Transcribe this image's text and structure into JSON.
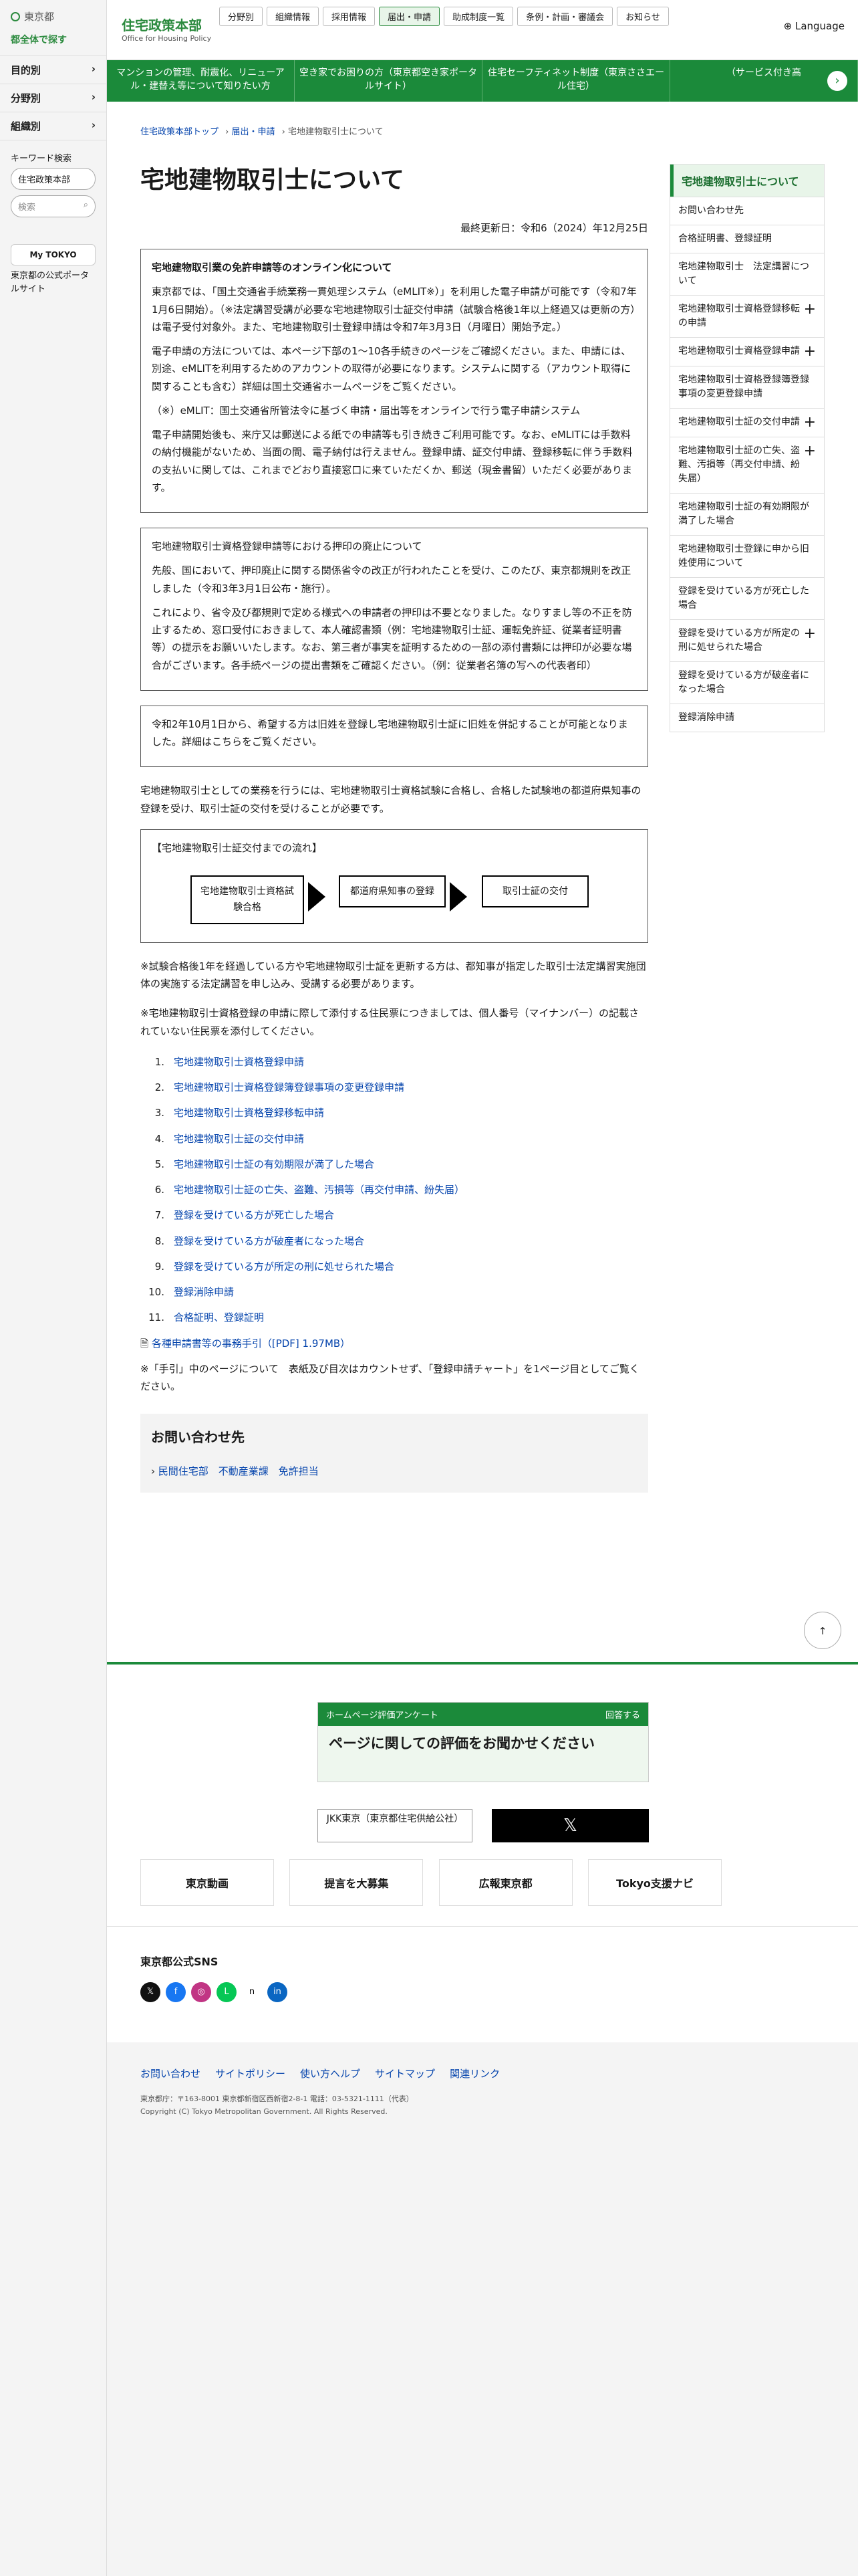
{
  "left": {
    "logo": "東京都",
    "all": "都全体で探す",
    "nav": [
      "目的別",
      "分野別",
      "組織別"
    ],
    "keyword": "キーワード検索",
    "select": "住宅政策本部",
    "search_placeholder": "検索",
    "mytokyo": "My TOKYO",
    "mytokyo_txt": "東京都の公式ポータルサイト"
  },
  "header": {
    "brand_jp": "住宅政策本部",
    "brand_en": "Office for Housing Policy",
    "menu": [
      "分野別",
      "組織情報",
      "採用情報",
      "届出・申請",
      "助成制度一覧",
      "条例・計画・審議会",
      "お知らせ"
    ],
    "lang": "Language"
  },
  "banner": [
    "マンションの管理、耐震化、リニューアル・建替え等について知りたい方",
    "空き家でお困りの方（東京都空き家ポータルサイト）",
    "住宅セーフティネット制度（東京ささエール住宅）",
    "（サービス付き高"
  ],
  "breadcrumb": [
    "住宅政策本部トップ",
    "届出・申請",
    "宅地建物取引士について"
  ],
  "title": "宅地建物取引士について",
  "updated": "最終更新日：令和6（2024）年12月25日",
  "box1": {
    "heading": "宅地建物取引業の免許申請等のオンライン化について",
    "p1": "東京都では、「国土交通省手続業務一貫処理システム（eMLIT※）」を利用した電子申請が可能です（令和7年1月6日開始）。（※法定講習受講が必要な宅地建物取引士証交付申請（試験合格後1年以上経過又は更新の方）は電子受付対象外。また、宅地建物取引士登録申請は令和7年3月3日（月曜日）開始予定。）",
    "p2": "電子申請の方法については、本ページ下部の1〜10各手続きのページをご確認ください。また、申請には、別途、eMLITを利用するためのアカウントの取得が必要になります。システムに関する（アカウント取得に関することも含む）詳細は国土交通省ホームページをご覧ください。",
    "p3": "（※）eMLIT：国土交通省所管法令に基づく申請・届出等をオンラインで行う電子申請システム",
    "p4": "電子申請開始後も、来庁又は郵送による紙での申請等も引き続きご利用可能です。なお、eMLITには手数料の納付機能がないため、当面の間、電子納付は行えません。登録申請、証交付申請、登録移転に伴う手数料の支払いに関しては、これまでどおり直接窓口に来ていただくか、郵送（現金書留）いただく必要があります。"
  },
  "box2": {
    "heading": "宅地建物取引士資格登録申請等における押印の廃止について",
    "p1": "先般、国において、押印廃止に関する関係省令の改正が行われたことを受け、このたび、東京都規則を改正しました（令和3年3月1日公布・施行）。",
    "p2": "これにより、省令及び都規則で定める様式への申請者の押印は不要となりました。なりすまし等の不正を防止するため、窓口受付におきまして、本人確認書類（例：宅地建物取引士証、運転免許証、従業者証明書等）の提示をお願いいたします。なお、第三者が事実を証明するための一部の添付書類には押印が必要な場合がございます。各手続ページの提出書類をご確認ください。（例：従業者名簿の写への代表者印）"
  },
  "box3": "令和2年10月1日から、希望する方は旧姓を登録し宅地建物取引士証に旧姓を併記することが可能となりました。詳細はこちらをご覧ください。",
  "intro": "宅地建物取引士としての業務を行うには、宅地建物取引士資格試験に合格し、合格した試験地の都道府県知事の登録を受け、取引士証の交付を受けることが必要です。",
  "flow": {
    "title": "【宅地建物取引士証交付までの流れ】",
    "steps": [
      "宅地建物取引士資格試験合格",
      "都道府県知事の登録",
      "取引士証の交付"
    ]
  },
  "note1": "※試験合格後1年を経過している方や宅地建物取引士証を更新する方は、都知事が指定した取引士法定講習実施団体の実施する法定講習を申し込み、受講する必要があります。",
  "note2": "※宅地建物取引士資格登録の申請に際して添付する住民票につきましては、個人番号（マイナンバー）の記載されていない住民票を添付してください。",
  "links": [
    "宅地建物取引士資格登録申請",
    "宅地建物取引士資格登録簿登録事項の変更登録申請",
    "宅地建物取引士資格登録移転申請",
    "宅地建物取引士証の交付申請",
    "宅地建物取引士証の有効期限が満了した場合",
    "宅地建物取引士証の亡失、盗難、汚損等（再交付申請、紛失届）",
    "登録を受けている方が死亡した場合",
    "登録を受けている方が破産者になった場合",
    "登録を受けている方が所定の刑に処せられた場合",
    "登録消除申請",
    "合格証明、登録証明"
  ],
  "pdf": "各種申請書等の事務手引（[PDF] 1.97MB）",
  "tebiki_note": "※「手引」中のページについて　表紙及び目次はカウントせず、「登録申請チャート」を1ページ目としてご覧ください。",
  "contact": {
    "title": "お問い合わせ先",
    "link": "民間住宅部　不動産業課　免許担当"
  },
  "side": {
    "head": "宅地建物取引士について",
    "items": [
      "お問い合わせ先",
      "合格証明書、登録証明",
      "宅地建物取引士　法定講習について",
      "宅地建物取引士資格登録移転の申請",
      "宅地建物取引士資格登録申請",
      "宅地建物取引士資格登録簿登録事項の変更登録申請",
      "宅地建物取引士証の交付申請",
      "宅地建物取引士証の亡失、盗難、汚損等（再交付申請、紛失届）",
      "宅地建物取引士証の有効期限が満了した場合",
      "宅地建物取引士登録に申から旧姓使用について",
      "登録を受けている方が死亡した場合",
      "登録を受けている方が所定の刑に処せられた場合",
      "登録を受けている方が破産者になった場合",
      "登録消除申請"
    ]
  },
  "survey": {
    "bar": "ホームページ評価アンケート",
    "answer": "回答する",
    "big": "ページに関しての評価をお聞かせください"
  },
  "jkk": "JKK東京（東京都住宅供給公社）",
  "ads": [
    "東京動画",
    "提言を大募集",
    "広報東京都",
    "Tokyo支援ナビ"
  ],
  "sns_title": "東京都公式SNS",
  "footer": {
    "links": [
      "お問い合わせ",
      "サイトポリシー",
      "使い方ヘルプ",
      "サイトマップ",
      "関連リンク"
    ],
    "address": "東京都庁：〒163-8001 東京都新宿区西新宿2-8-1 電話：03-5321-1111（代表）",
    "copyright": "Copyright (C) Tokyo Metropolitan Government. All Rights Reserved."
  }
}
